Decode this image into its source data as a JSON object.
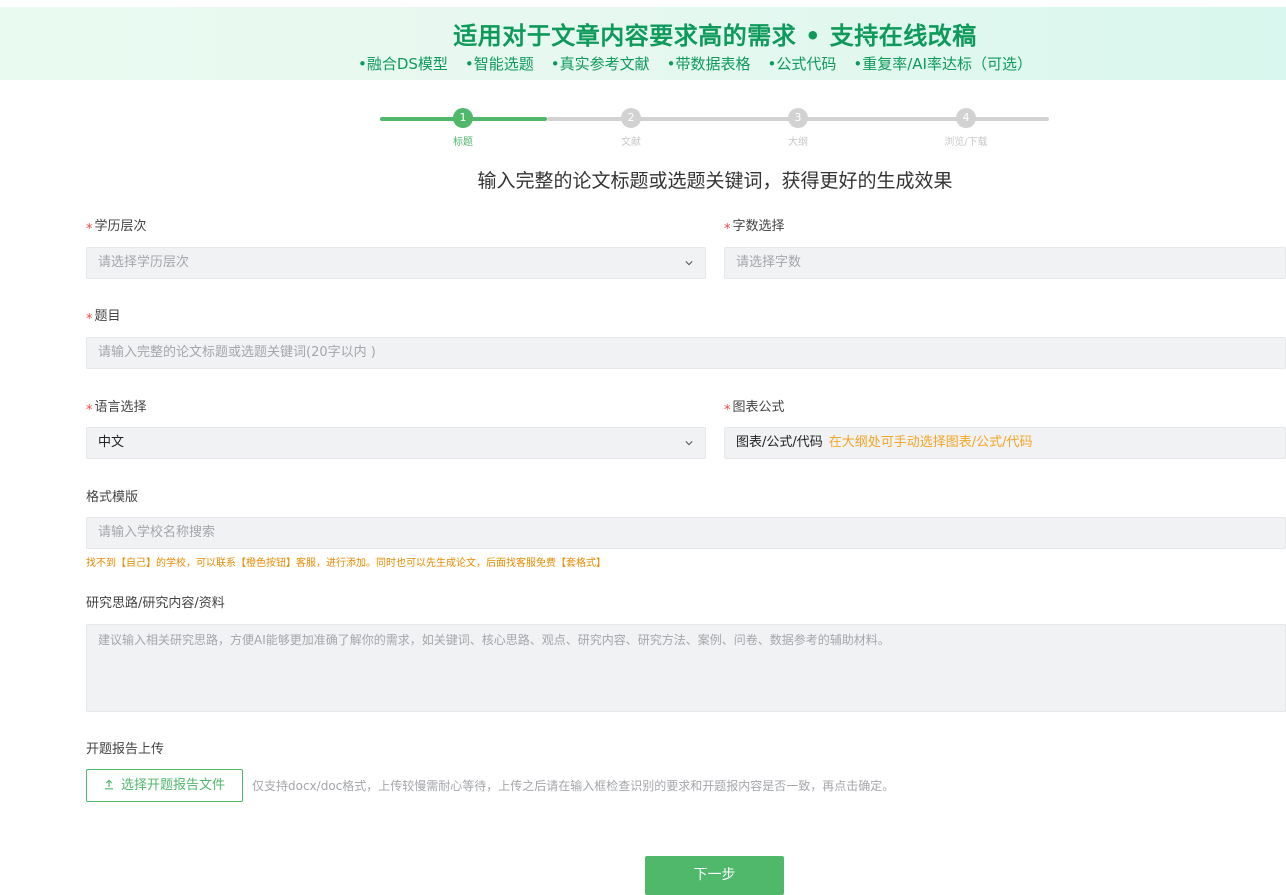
{
  "banner": {
    "title": "适用对于文章内容要求高的需求 • 支持在线改稿",
    "features": [
      "•融合DS模型",
      "•智能选题",
      "•真实参考文献",
      "•带数据表格",
      "•公式代码",
      "•重复率/AI率达标（可选）"
    ]
  },
  "steps": [
    {
      "number": "1",
      "label": "标题",
      "active": true
    },
    {
      "number": "2",
      "label": "文献",
      "active": false
    },
    {
      "number": "3",
      "label": "大纲",
      "active": false
    },
    {
      "number": "4",
      "label": "浏览/下载",
      "active": false
    }
  ],
  "subtitle": "输入完整的论文标题或选题关键词，获得更好的生成效果",
  "form": {
    "required_mark": "*",
    "education": {
      "label": "学历层次",
      "placeholder": "请选择学历层次"
    },
    "word_count": {
      "label": "字数选择",
      "placeholder": "请选择字数"
    },
    "topic": {
      "label": "题目",
      "placeholder": "请输入完整的论文标题或选题关键词(20字以内 )"
    },
    "language": {
      "label": "语言选择",
      "value": "中文"
    },
    "charts": {
      "label": "图表公式",
      "value": "图表/公式/代码",
      "hint": "在大纲处可手动选择图表/公式/代码"
    },
    "template": {
      "label": "格式模版",
      "placeholder": "请输入学校名称搜索",
      "note": "找不到【自己】的学校，可以联系【橙色按钮】客服，进行添加。同时也可以先生成论文，后面找客服免费【套格式】"
    },
    "research": {
      "label": "研究思路/研究内容/资料",
      "placeholder": "建议输入相关研究思路，方便AI能够更加准确了解你的需求，如关键词、核心思路、观点、研究内容、研究方法、案例、问卷、数据参考的辅助材料。"
    },
    "upload": {
      "label": "开题报告上传",
      "button": "选择开题报告文件",
      "hint": "仅支持docx/doc格式，上传较慢需耐心等待，上传之后请在输入框检查识别的要求和开题报内容是否一致，再点击确定。"
    }
  },
  "next_button": "下一步",
  "colors": {
    "brand_green": "#4fb86a",
    "banner_green": "#0d9a5b",
    "warning_orange": "#f5a524",
    "required_red": "#f04848"
  }
}
